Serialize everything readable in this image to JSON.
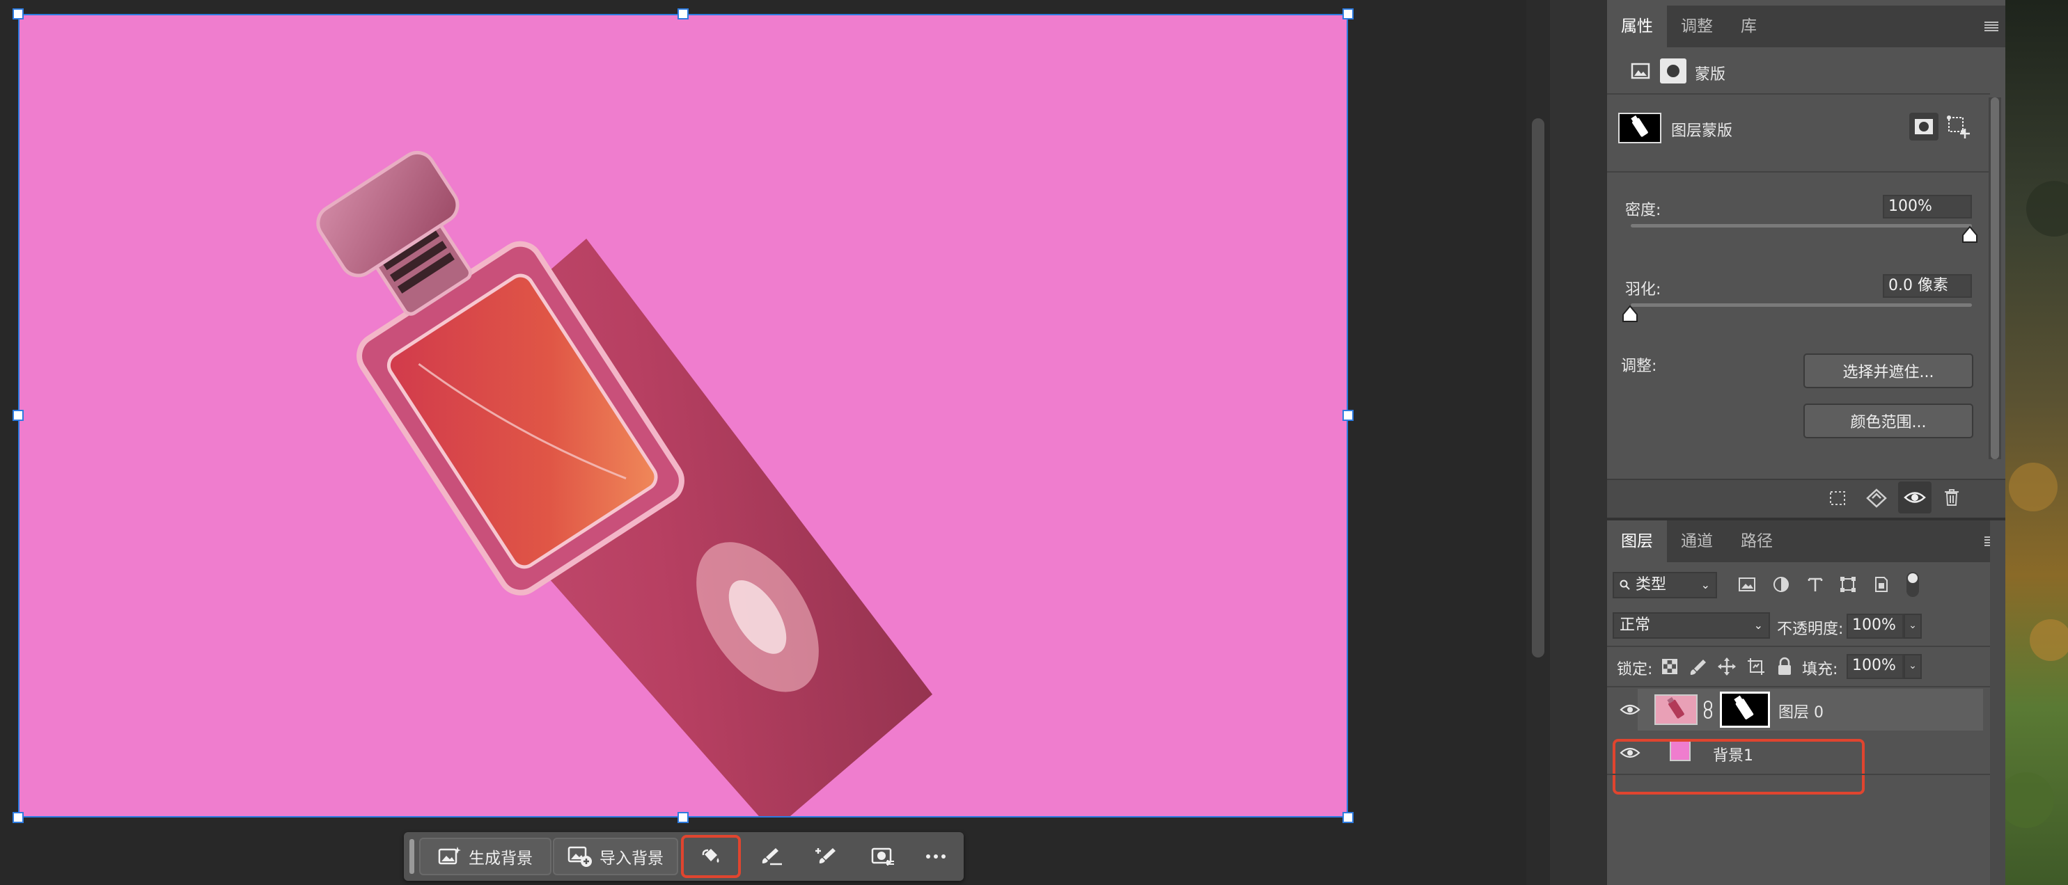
{
  "taskbar": {
    "generate_bg": "生成背景",
    "import_bg": "导入背景"
  },
  "properties": {
    "tabs": [
      "属性",
      "调整",
      "库"
    ],
    "mask_label": "蒙版",
    "layer_mask_label": "图层蒙版",
    "density_label": "密度:",
    "density_value": "100%",
    "density_level": 1.0,
    "feather_label": "羽化:",
    "feather_value": "0.0 像素",
    "feather_level": 0.0,
    "adjust_label": "调整:",
    "select_mask_btn": "选择并遮住...",
    "color_range_btn": "颜色范围..."
  },
  "layers": {
    "tabs": [
      "图层",
      "通道",
      "路径"
    ],
    "filter_type": "类型",
    "blend_mode": "正常",
    "opacity_label": "不透明度:",
    "opacity_value": "100%",
    "lock_label": "锁定:",
    "fill_label": "填充:",
    "fill_value": "100%",
    "items": [
      {
        "name": "图层 0"
      },
      {
        "name": "背景1"
      }
    ]
  },
  "colors": {
    "canvas_bg": "#ef7dce",
    "selection": "#2d7be0",
    "highlight": "#e0452f",
    "panel": "#535353"
  },
  "icons": [
    "generate-image-icon",
    "import-image-icon",
    "paint-bucket-icon",
    "brush-icon",
    "brush-plus-icon",
    "mask-adjust-icon",
    "more-icon",
    "eye-icon",
    "trash-icon",
    "link-icon",
    "lock-icon"
  ]
}
